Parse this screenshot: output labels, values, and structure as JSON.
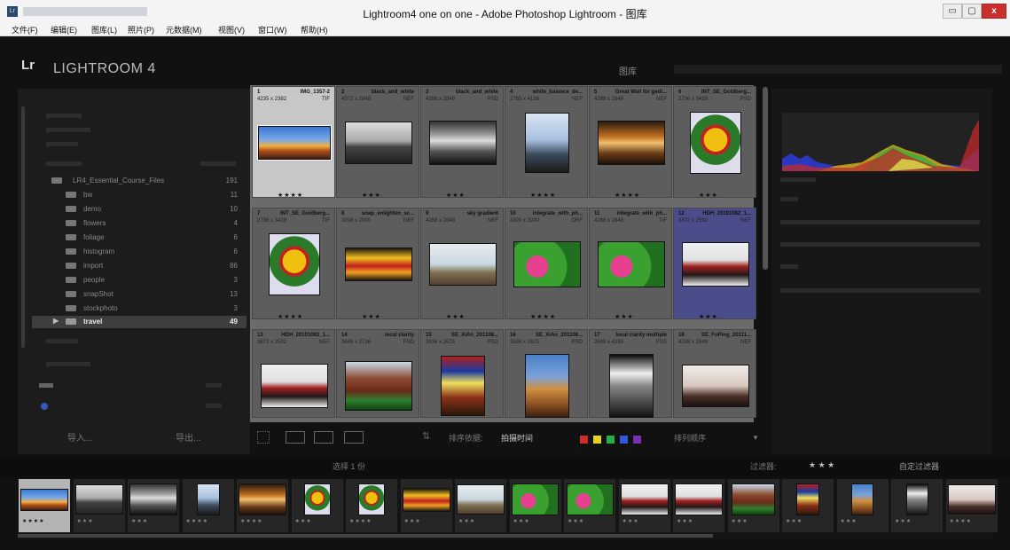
{
  "window": {
    "title": "Lightroom4 one on one - Adobe Photoshop Lightroom - 图库",
    "min": "▭",
    "max": "▢",
    "close": "x"
  },
  "menu": [
    "文件(F)",
    "编辑(E)",
    "图库(L)",
    "照片(P)",
    "元数据(M)",
    "视图(V)",
    "窗口(W)",
    "帮助(H)"
  ],
  "header": {
    "logo": "Lr",
    "app_name": "LIGHTROOM 4",
    "module": "图库"
  },
  "folders": {
    "root": {
      "name": "LR4_Essential_Course_Files",
      "count": "191"
    },
    "items": [
      {
        "name": "bw",
        "count": "11"
      },
      {
        "name": "demo",
        "count": "10"
      },
      {
        "name": "flowers",
        "count": "4"
      },
      {
        "name": "foliage",
        "count": "6"
      },
      {
        "name": "histogram",
        "count": "6"
      },
      {
        "name": "import",
        "count": "86"
      },
      {
        "name": "people",
        "count": "3"
      },
      {
        "name": "snapShot",
        "count": "13"
      },
      {
        "name": "stockphoto",
        "count": "3"
      }
    ],
    "selected": {
      "name": "travel",
      "count": "49"
    }
  },
  "left_buttons": {
    "import": "导入...",
    "export": "导出..."
  },
  "grid": [
    {
      "idx": "1",
      "name": "IMG_1357-2",
      "dims": "4235 x 2382",
      "ext": "TIF",
      "stars": "★★★★",
      "thumb": "sunset-panorama",
      "selected": true
    },
    {
      "idx": "2",
      "name": "black_and_white",
      "dims": "4272 x 2848",
      "ext": "NEF",
      "stars": "★★★·",
      "thumb": "bw-landscape"
    },
    {
      "idx": "3",
      "name": "black_and_white",
      "dims": "4288 x 2848",
      "ext": "PSD",
      "stars": "★★★·",
      "thumb": "bw-clouds"
    },
    {
      "idx": "4",
      "name": "white_balance_de...",
      "dims": "2765 x 4156",
      "ext": "NEF",
      "stars": "★★★★",
      "thumb": "white-balance-portrait"
    },
    {
      "idx": "5",
      "name": "Great Wall for gedi...",
      "dims": "4288 x 2848",
      "ext": "NEF",
      "stars": "★★★★",
      "thumb": "great-wall-sunset"
    },
    {
      "idx": "6",
      "name": "INT_SE_Goldberg...",
      "dims": "2736 x 3429",
      "ext": "PSD",
      "stars": "★★★·",
      "thumb": "warning-sign"
    },
    {
      "idx": "7",
      "name": "INT_SE_Goldberg...",
      "dims": "2736 x 3429",
      "ext": "TIF",
      "stars": "★★★★",
      "thumb": "warning-sign"
    },
    {
      "idx": "8",
      "name": "snap_enlighten_sc...",
      "dims": "3008 x 2000",
      "ext": "NEF",
      "stars": "★★★·",
      "thumb": "street-scene"
    },
    {
      "idx": "9",
      "name": "sky gradient",
      "dims": "4288 x 2848",
      "ext": "NEF",
      "stars": "★★★·",
      "thumb": "sky-gradient"
    },
    {
      "idx": "10",
      "name": "integrate_with_ph...",
      "dims": "4320 x 3240",
      "ext": "ORF",
      "stars": "★★★★",
      "thumb": "pink-flowers"
    },
    {
      "idx": "11",
      "name": "integrate_with_ph...",
      "dims": "4288 x 2848",
      "ext": "TIF",
      "stars": "★★★·",
      "thumb": "pink-flowers"
    },
    {
      "idx": "12",
      "name": "HDH_20101082_1...",
      "dims": "3872 x 2592",
      "ext": "NEF",
      "stars": "★★★·",
      "thumb": "people-scene"
    },
    {
      "idx": "13",
      "name": "HDH_20101082_1...",
      "dims": "3872 x 2592",
      "ext": "NEF",
      "stars": "",
      "thumb": "people-scene"
    },
    {
      "idx": "14",
      "name": "local clarity",
      "dims": "3648 x 2736",
      "ext": "PSD",
      "stars": "",
      "thumb": "rock-landscape"
    },
    {
      "idx": "15",
      "name": "SE_XiAn_201108...",
      "dims": "3936 x 2625",
      "ext": "PSD",
      "stars": "",
      "thumb": "red-sign-gate"
    },
    {
      "idx": "16",
      "name": "SE_XiAn_201108...",
      "dims": "3636 x 2625",
      "ext": "PSD",
      "stars": "",
      "thumb": "temple-gate"
    },
    {
      "idx": "17",
      "name": "local clarity multiple",
      "dims": "2848 x 4288",
      "ext": "PSD",
      "stars": "",
      "thumb": "bw-portrait"
    },
    {
      "idx": "18",
      "name": "SE_FoPing_20111...",
      "dims": "4288 x 2848",
      "ext": "NEF",
      "stars": "",
      "thumb": "pale-landscape"
    }
  ],
  "toolbar": {
    "sort_label": "排序依据:",
    "sort_value": "拍摄时间",
    "rating_label": "排列顺序"
  },
  "colors": {
    "red": "#d12b2b",
    "yellow": "#e8d21e",
    "green": "#27b04a",
    "blue": "#3558d8",
    "purple": "#7a2fb8",
    "accent": "#4a4d8a"
  },
  "bottom_bar": {
    "status": "选择 1 份",
    "filter": "过滤器:",
    "filter_stars": "★ ★ ★",
    "filter_custom": "自定过滤器"
  },
  "filmstrip": [
    {
      "thumb": "sunset-panorama",
      "stars": "★★★★",
      "selected": true
    },
    {
      "thumb": "bw-landscape",
      "stars": "★★★"
    },
    {
      "thumb": "bw-clouds",
      "stars": "★★★"
    },
    {
      "thumb": "white-balance-portrait",
      "stars": "★★★★"
    },
    {
      "thumb": "great-wall-sunset",
      "stars": "★★★★"
    },
    {
      "thumb": "warning-sign",
      "stars": "★★★"
    },
    {
      "thumb": "warning-sign",
      "stars": "★★★★"
    },
    {
      "thumb": "street-scene",
      "stars": "★★★"
    },
    {
      "thumb": "sky-gradient",
      "stars": "★★★"
    },
    {
      "thumb": "pink-flowers",
      "stars": "★★★"
    },
    {
      "thumb": "pink-flowers",
      "stars": "★★★"
    },
    {
      "thumb": "people-scene",
      "stars": "★★★"
    },
    {
      "thumb": "people-scene",
      "stars": "★★★"
    },
    {
      "thumb": "rock-landscape",
      "stars": "★★★"
    },
    {
      "thumb": "red-sign-gate",
      "stars": "★★★"
    },
    {
      "thumb": "temple-gate",
      "stars": "★★★"
    },
    {
      "thumb": "bw-portrait",
      "stars": "★★★"
    },
    {
      "thumb": "pale-landscape",
      "stars": "★★★★"
    }
  ]
}
